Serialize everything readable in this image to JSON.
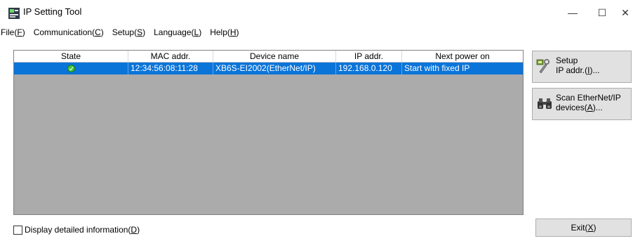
{
  "window": {
    "title": "IP Setting Tool",
    "min_glyph": "—",
    "max_glyph": "☐",
    "close_glyph": "✕"
  },
  "menu": [
    {
      "label": "File",
      "mnemonic": "F"
    },
    {
      "label": "Communication",
      "mnemonic": "C"
    },
    {
      "label": "Setup",
      "mnemonic": "S"
    },
    {
      "label": "Language",
      "mnemonic": "L"
    },
    {
      "label": "Help",
      "mnemonic": "H"
    }
  ],
  "table": {
    "columns": [
      "State",
      "MAC addr.",
      "Device name",
      "IP addr.",
      "Next power on"
    ],
    "rows": [
      {
        "state": "connected-ok",
        "mac": "12:34:56:08:11:28",
        "device": "XB6S-EI2002(EtherNet/IP)",
        "ip": "192.168.0.120",
        "next_power_on": "Start with fixed IP"
      }
    ],
    "selected_row_color": "#0a74d9"
  },
  "buttons": {
    "setup": {
      "line1": "Setup",
      "line2": "IP addr.(",
      "mnemonic": "I",
      "line2_tail": ")...",
      "icon": "network-wrench-icon"
    },
    "scan": {
      "line1": "Scan EtherNet/IP",
      "line2": "devices(",
      "mnemonic": "A",
      "line2_tail": ")...",
      "icon": "binoculars-icon"
    },
    "exit": {
      "label": "Exit(",
      "mnemonic": "X",
      "tail": ")"
    }
  },
  "detail_checkbox": {
    "label": "Display detailed information(",
    "mnemonic": "D",
    "tail": ")",
    "checked": false
  }
}
